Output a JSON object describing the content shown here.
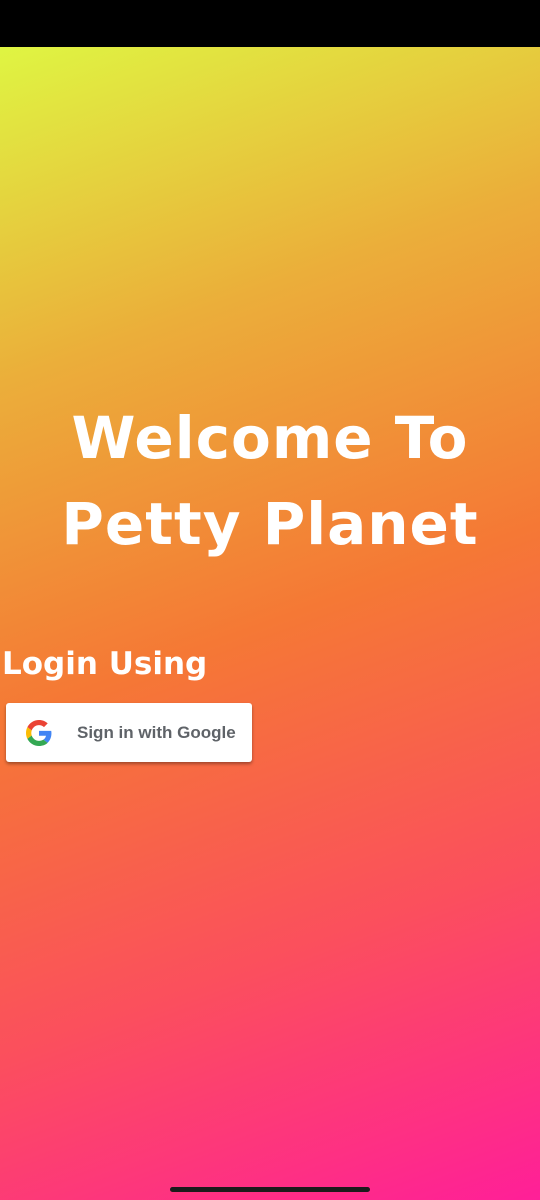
{
  "welcome": {
    "title": "Welcome To\nPetty Planet"
  },
  "login": {
    "label": "Login Using",
    "google_button_label": "Sign in with Google",
    "google_icon": "google-g-icon"
  },
  "colors": {
    "gradient_start": "#dff542",
    "gradient_mid": "#f57835",
    "gradient_end": "#ff1f98",
    "text": "#ffffff",
    "button_text": "#5f6368"
  }
}
